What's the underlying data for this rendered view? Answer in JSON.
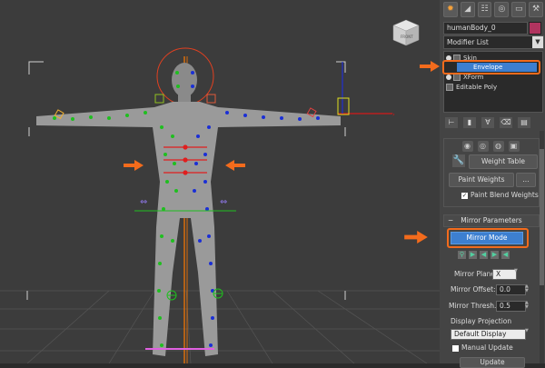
{
  "viewport": {
    "gizmo_label": "FRONT",
    "selection_color": "#c8c8c8"
  },
  "command_panel": {
    "tabs": [
      {
        "icon": "sun-icon"
      },
      {
        "icon": "modify-icon"
      },
      {
        "icon": "hierarchy-icon"
      },
      {
        "icon": "motion-icon"
      },
      {
        "icon": "display-icon"
      },
      {
        "icon": "utilities-icon"
      }
    ],
    "object_name": "humanBody_0",
    "object_color": "#b0345f",
    "modifier_list": "Modifier List",
    "stack": [
      {
        "label": "Skin"
      },
      {
        "label": "Envelope"
      },
      {
        "label": "XForm"
      },
      {
        "label": "Editable Poly"
      }
    ],
    "weight_table_label": "Weight Table",
    "paint_weights_label": "Paint Weights",
    "ellipsis_label": "...",
    "paint_blend_weights_label": "Paint Blend Weights",
    "mirror_parameters_title": "Mirror Parameters",
    "mirror_mode_label": "Mirror Mode",
    "mirror_plane_label": "Mirror Plane:",
    "mirror_plane_value": "X",
    "mirror_offset_label": "Mirror Offset:",
    "mirror_offset_value": "0.0",
    "mirror_thresh_label": "Mirror Thresh.:",
    "mirror_thresh_value": "0.5",
    "display_projection_label": "Display Projection",
    "display_projection_value": "Default Display",
    "manual_update_label": "Manual Update",
    "update_label": "Update"
  },
  "colors": {
    "accent_orange": "#f36b1c",
    "selected_blue": "#3d7fd0",
    "skin_green": "#1fbf1f",
    "vertex_blue": "#1a2fd6",
    "bone_red": "#e01f1f"
  }
}
